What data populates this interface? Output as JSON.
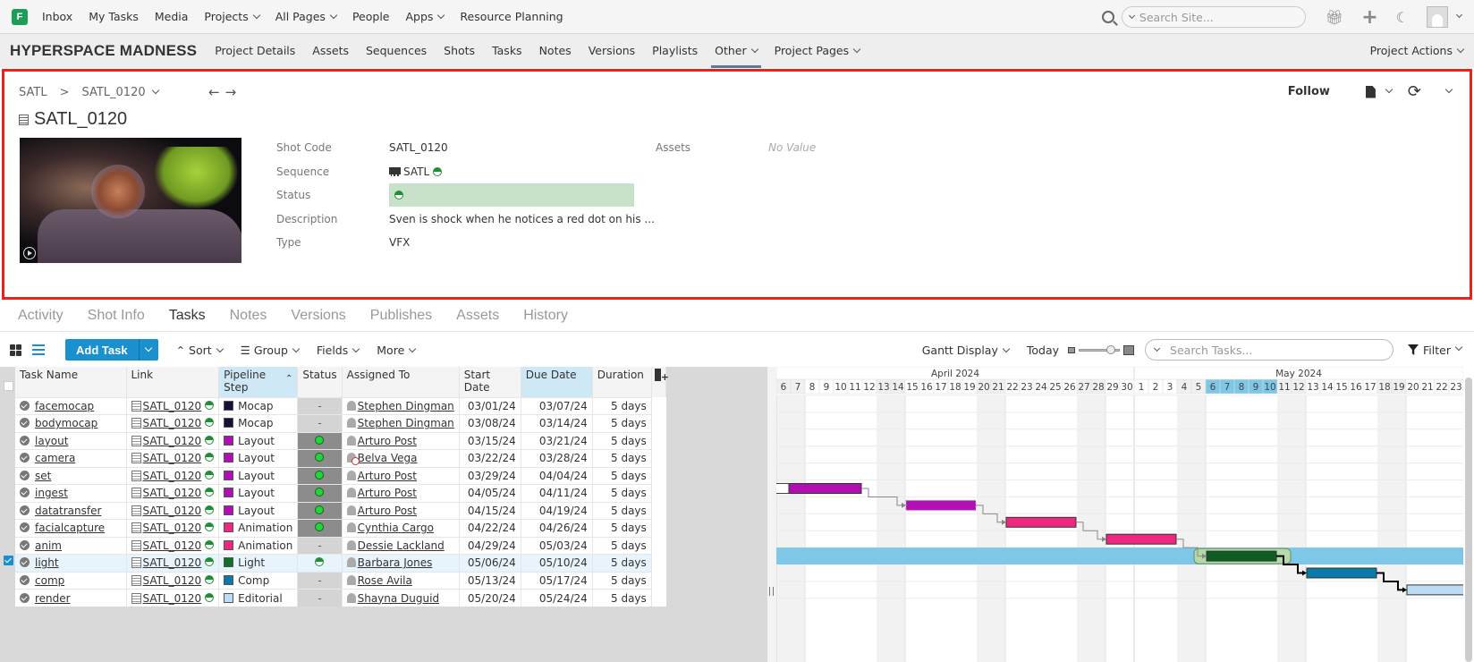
{
  "topnav": {
    "logo": "F",
    "items": [
      "Inbox",
      "My Tasks",
      "Media",
      "Projects",
      "All Pages",
      "People",
      "Apps",
      "Resource Planning"
    ],
    "dropdowns": [
      false,
      false,
      false,
      true,
      true,
      false,
      true,
      false
    ],
    "search_placeholder": "Search Site...",
    "icons": [
      "gift-icon",
      "plus-icon",
      "moon-icon",
      "avatar"
    ]
  },
  "project": {
    "title": "HYPERSPACE MADNESS",
    "nav": [
      "Project Details",
      "Assets",
      "Sequences",
      "Shots",
      "Tasks",
      "Notes",
      "Versions",
      "Playlists",
      "Other",
      "Project Pages"
    ],
    "nav_dropdowns": [
      false,
      false,
      false,
      false,
      false,
      false,
      false,
      false,
      true,
      true
    ],
    "active_nav": "Other",
    "actions_label": "Project Actions"
  },
  "detail": {
    "breadcrumb": {
      "parent": "SATL",
      "separator": ">",
      "current": "SATL_0120"
    },
    "title": "SATL_0120",
    "follow_label": "Follow",
    "fields": [
      {
        "label": "Shot Code",
        "value": "SATL_0120"
      },
      {
        "label": "Sequence",
        "value": "SATL"
      },
      {
        "label": "Status",
        "value": ""
      },
      {
        "label": "Description",
        "value": "Sven is shock when he notices a red dot on his ..."
      },
      {
        "label": "Type",
        "value": "VFX"
      }
    ],
    "assets_label": "Assets",
    "assets_value": "No Value"
  },
  "tabs": {
    "items": [
      "Activity",
      "Shot Info",
      "Tasks",
      "Notes",
      "Versions",
      "Publishes",
      "Assets",
      "History"
    ],
    "active": "Tasks"
  },
  "toolbar": {
    "add_task": "Add Task",
    "sort": "Sort",
    "group": "Group",
    "fields": "Fields",
    "more": "More",
    "gantt_display": "Gantt Display",
    "today": "Today",
    "search_placeholder": "Search Tasks...",
    "filter": "Filter"
  },
  "table": {
    "columns": [
      "Task Name",
      "Link",
      "Pipeline Step",
      "Status",
      "Assigned To",
      "Start Date",
      "Due Date",
      "Duration"
    ],
    "rows": [
      {
        "task": "facemocap",
        "link": "SATL_0120",
        "step": "Mocap",
        "step_color": "#14103a",
        "status": "-",
        "assignee": "Stephen Dingman",
        "start": "03/01/24",
        "due": "03/07/24",
        "duration": "5 days"
      },
      {
        "task": "bodymocap",
        "link": "SATL_0120",
        "step": "Mocap",
        "step_color": "#14103a",
        "status": "-",
        "assignee": "Stephen Dingman",
        "start": "03/08/24",
        "due": "03/14/24",
        "duration": "5 days"
      },
      {
        "task": "layout",
        "link": "SATL_0120",
        "step": "Layout",
        "step_color": "#b10fb3",
        "status": "green",
        "assignee": "Arturo Post",
        "start": "03/15/24",
        "due": "03/21/24",
        "duration": "5 days"
      },
      {
        "task": "camera",
        "link": "SATL_0120",
        "step": "Layout",
        "step_color": "#b10fb3",
        "status": "green",
        "assignee": "Belva Vega",
        "assignee_inactive": true,
        "start": "03/22/24",
        "due": "03/28/24",
        "duration": "5 days"
      },
      {
        "task": "set",
        "link": "SATL_0120",
        "step": "Layout",
        "step_color": "#b10fb3",
        "status": "green",
        "assignee": "Arturo Post",
        "start": "03/29/24",
        "due": "04/04/24",
        "duration": "5 days"
      },
      {
        "task": "ingest",
        "link": "SATL_0120",
        "step": "Layout",
        "step_color": "#b10fb3",
        "status": "green",
        "assignee": "Arturo Post",
        "start": "04/05/24",
        "due": "04/11/24",
        "duration": "5 days"
      },
      {
        "task": "datatransfer",
        "link": "SATL_0120",
        "step": "Layout",
        "step_color": "#b10fb3",
        "status": "green",
        "assignee": "Arturo Post",
        "start": "04/15/24",
        "due": "04/19/24",
        "duration": "5 days"
      },
      {
        "task": "facialcapture",
        "link": "SATL_0120",
        "step": "Animation",
        "step_color": "#f0277e",
        "status": "green",
        "assignee": "Cynthia Cargo",
        "start": "04/22/24",
        "due": "04/26/24",
        "duration": "5 days"
      },
      {
        "task": "anim",
        "link": "SATL_0120",
        "step": "Animation",
        "step_color": "#f0277e",
        "status": "-",
        "assignee": "Dessie Lackland",
        "start": "04/29/24",
        "due": "05/03/24",
        "duration": "5 days"
      },
      {
        "task": "light",
        "link": "SATL_0120",
        "step": "Light",
        "step_color": "#127029",
        "status": "half",
        "assignee": "Barbara Jones",
        "start": "05/06/24",
        "due": "05/10/24",
        "duration": "5 days",
        "selected": true
      },
      {
        "task": "comp",
        "link": "SATL_0120",
        "step": "Comp",
        "step_color": "#0a7aab",
        "status": "-",
        "assignee": "Rose Avila",
        "start": "05/13/24",
        "due": "05/17/24",
        "duration": "5 days"
      },
      {
        "task": "render",
        "link": "SATL_0120",
        "step": "Editorial",
        "step_color": "#bcdcf6",
        "status": "-",
        "assignee": "Shayna Duguid",
        "start": "05/20/24",
        "due": "05/24/24",
        "duration": "5 days"
      }
    ]
  },
  "gantt": {
    "months": [
      {
        "label": "April 2024"
      },
      {
        "label": "May 2024"
      }
    ],
    "first_day": "2024-04-06",
    "last_day": "2024-05-23",
    "highlight_start": "2024-05-06",
    "highlight_end": "2024-05-10",
    "bars": [
      {
        "task": "ingest",
        "start": "2024-04-05",
        "end": "2024-04-11",
        "color": "#b10fb3"
      },
      {
        "task": "datatransfer",
        "start": "2024-04-15",
        "end": "2024-04-19",
        "color": "#b10fb3",
        "dashed": true
      },
      {
        "task": "facialcapture",
        "start": "2024-04-22",
        "end": "2024-04-26",
        "color": "#f0277e"
      },
      {
        "task": "anim",
        "start": "2024-04-29",
        "end": "2024-05-03",
        "color": "#f0277e"
      },
      {
        "task": "light",
        "start": "2024-05-06",
        "end": "2024-05-10",
        "color": "#0d5e24",
        "selected": true
      },
      {
        "task": "comp",
        "start": "2024-05-13",
        "end": "2024-05-17",
        "color": "#0a7aab"
      },
      {
        "task": "render",
        "start": "2024-05-20",
        "end": "2024-05-24",
        "color": "#bcdcf6"
      }
    ]
  }
}
